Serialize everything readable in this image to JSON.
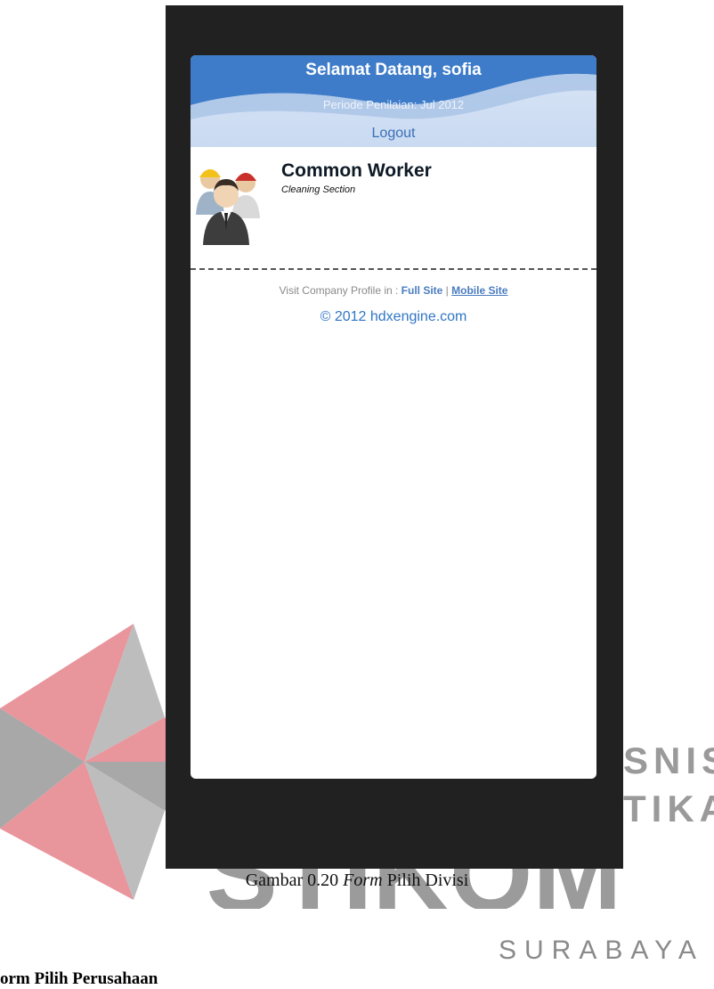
{
  "header": {
    "welcome": "Selamat Datang, sofia",
    "period": "Periode Penilaian: Jul 2012",
    "logout_label": "Logout"
  },
  "division": {
    "title": "Common Worker",
    "subtitle": "Cleaning Section",
    "icon": "workers-group-icon"
  },
  "footer": {
    "visit_prefix": "Visit Company Profile in : ",
    "full_site": "Full Site",
    "separator": " | ",
    "mobile_site": "Mobile Site",
    "copyright": "© 2012 hdxengine.com"
  },
  "caption": {
    "prefix": "Gambar 0.20 ",
    "italic": "Form",
    "suffix": " Pilih Divisi"
  },
  "section_heading": "orm Pilih Perusahaan",
  "watermark": {
    "line_right_1": "SNIS",
    "line_right_2": "TIKA",
    "brand": "STIKOM",
    "city": "SURABAYA"
  },
  "colors": {
    "phone_frame": "#212121",
    "header_bg": "#c9daf2",
    "link_blue": "#3a6fb6",
    "watermark_red": "#e08a94",
    "watermark_gray": "#9a9a9a"
  }
}
